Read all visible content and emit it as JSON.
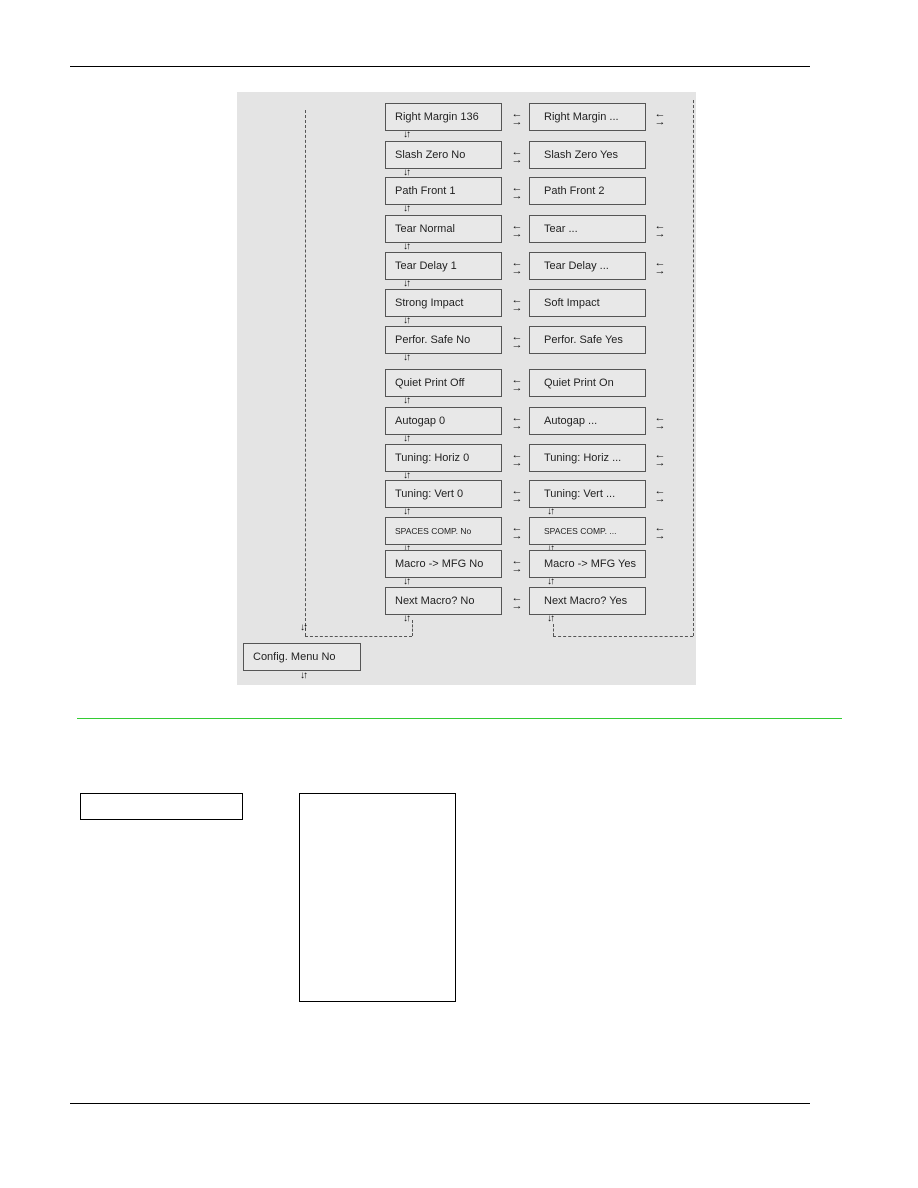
{
  "diagram": {
    "rows": [
      {
        "left": "Right Margin 136",
        "right": "Right Margin ...",
        "right_more": true
      },
      {
        "left": "Slash Zero No",
        "right": "Slash Zero Yes",
        "right_more": false
      },
      {
        "left": "Path Front 1",
        "right": "Path Front 2",
        "right_more": false
      },
      {
        "left": "Tear Normal",
        "right": "Tear ...",
        "right_more": true
      },
      {
        "left": "Tear Delay 1",
        "right": "Tear Delay ...",
        "right_more": true
      },
      {
        "left": "Strong Impact",
        "right": "Soft Impact",
        "right_more": false
      },
      {
        "left": "Perfor. Safe No",
        "right": "Perfor. Safe Yes",
        "right_more": false
      },
      {
        "left": "Quiet Print Off",
        "right": "Quiet Print On",
        "right_more": false
      },
      {
        "left": "Autogap 0",
        "right": "Autogap ...",
        "right_more": true
      },
      {
        "left": "Tuning: Horiz 0",
        "right": "Tuning: Horiz ...",
        "right_more": true
      },
      {
        "left": "Tuning: Vert 0",
        "right": "Tuning: Vert ...",
        "right_more": true
      },
      {
        "left": "SPACES COMP.  No",
        "right": "SPACES COMP.  ...",
        "right_more": true,
        "small": true
      },
      {
        "left": "Macro -> MFG No",
        "right": "Macro -> MFG Yes",
        "right_more": false
      },
      {
        "left": "Next Macro? No",
        "right": "Next Macro? Yes",
        "right_more": false
      }
    ],
    "config_menu": "Config. Menu No",
    "icons": {
      "swap": "swap-arrows-icon",
      "updown": "up-down-arrows-icon"
    }
  },
  "colors": {
    "divider": "#33cc33",
    "diagram_bg": "#e4e4e4"
  }
}
